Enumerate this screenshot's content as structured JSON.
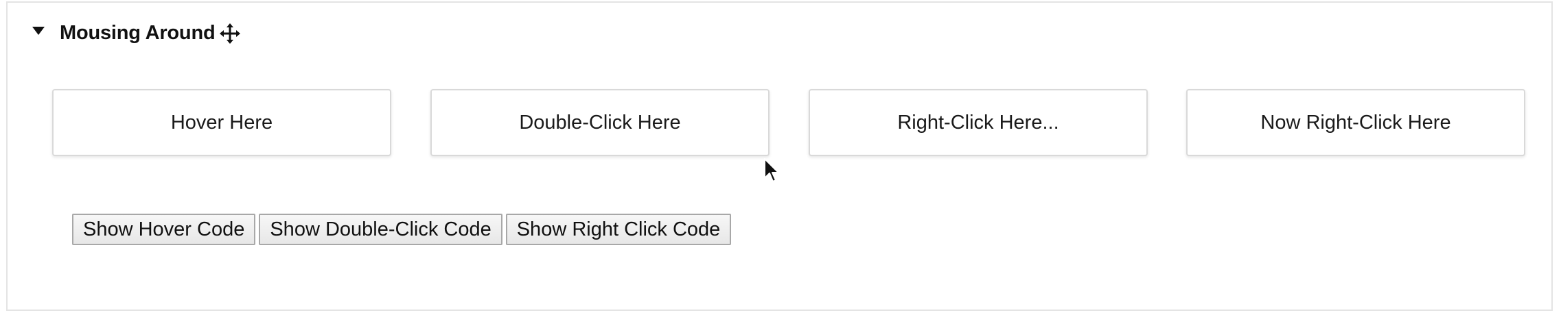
{
  "section": {
    "title": "Mousing Around"
  },
  "targets": [
    {
      "label": "Hover Here"
    },
    {
      "label": "Double-Click Here"
    },
    {
      "label": "Right-Click Here..."
    },
    {
      "label": "Now Right-Click Here"
    }
  ],
  "code_buttons": [
    {
      "label": "Show Hover Code"
    },
    {
      "label": "Show Double-Click Code"
    },
    {
      "label": "Show Right Click Code"
    }
  ],
  "icons": {
    "collapse": "caret-down-icon",
    "drag": "move-icon",
    "pointer": "mouse-pointer-icon"
  }
}
